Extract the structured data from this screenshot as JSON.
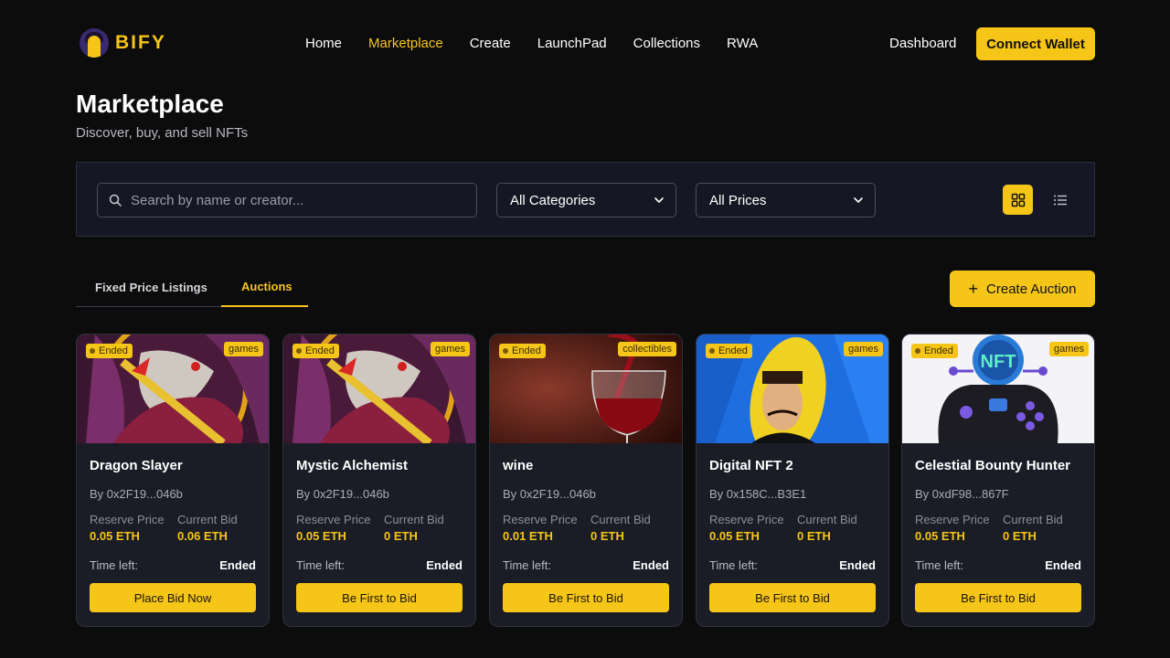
{
  "brand": {
    "name": "BIFY"
  },
  "nav": {
    "links": [
      "Home",
      "Marketplace",
      "Create",
      "LaunchPad",
      "Collections",
      "RWA"
    ],
    "active": "Marketplace",
    "dashboard": "Dashboard",
    "connect_wallet": "Connect Wallet"
  },
  "page": {
    "title": "Marketplace",
    "subtitle": "Discover, buy, and sell NFTs"
  },
  "filters": {
    "search_placeholder": "Search by name or creator...",
    "category": "All Categories",
    "price": "All Prices",
    "view_mode": "grid"
  },
  "tabs": {
    "fixed": "Fixed Price Listings",
    "auctions": "Auctions",
    "active": "auctions"
  },
  "create_auction": "Create Auction",
  "labels": {
    "reserve": "Reserve Price",
    "current": "Current Bid",
    "time_left": "Time left:"
  },
  "accent_color": "#f5c518",
  "cards": [
    {
      "status": "Ended",
      "category": "games",
      "name": "Dragon Slayer",
      "creator": "By 0x2F19...046b",
      "reserve": "0.05 ETH",
      "current": "0.06 ETH",
      "time": "Ended",
      "button": "Place Bid Now",
      "image": "dragon"
    },
    {
      "status": "Ended",
      "category": "games",
      "name": "Mystic Alchemist",
      "creator": "By 0x2F19...046b",
      "reserve": "0.05 ETH",
      "current": "0 ETH",
      "time": "Ended",
      "button": "Be First to Bid",
      "image": "dragon"
    },
    {
      "status": "Ended",
      "category": "collectibles",
      "name": "wine",
      "creator": "By 0x2F19...046b",
      "reserve": "0.01 ETH",
      "current": "0 ETH",
      "time": "Ended",
      "button": "Be First to Bid",
      "image": "wine"
    },
    {
      "status": "Ended",
      "category": "games",
      "name": "Digital NFT 2",
      "creator": "By 0x158C...B3E1",
      "reserve": "0.05 ETH",
      "current": "0 ETH",
      "time": "Ended",
      "button": "Be First to Bid",
      "image": "banana"
    },
    {
      "status": "Ended",
      "category": "games",
      "name": "Celestial Bounty Hunter",
      "creator": "By 0xdF98...867F",
      "reserve": "0.05 ETH",
      "current": "0 ETH",
      "time": "Ended",
      "button": "Be First to Bid",
      "image": "gamepad"
    }
  ]
}
